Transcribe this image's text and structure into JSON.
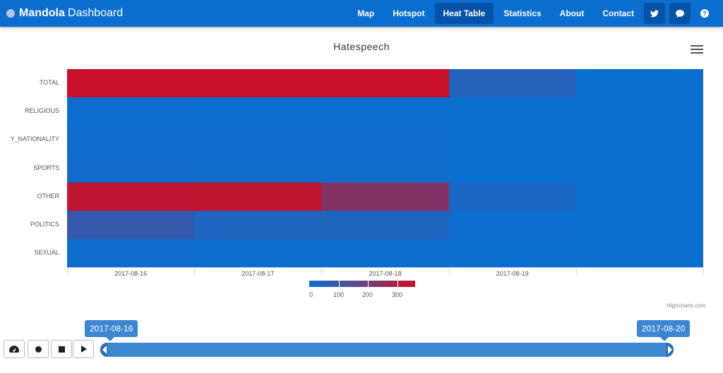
{
  "brand": {
    "name_bold": "Mandola",
    "name_light": "Dashboard"
  },
  "nav": {
    "items": [
      "Map",
      "Hotspot",
      "Heat Table",
      "Statistics",
      "About",
      "Contact"
    ],
    "active": "Heat Table",
    "icons": [
      "twitter-icon",
      "chat-icon",
      "help-icon"
    ]
  },
  "chart": {
    "title": "Hatespeech",
    "credits": "Highcharts.com",
    "legend": {
      "ticks": [
        "0",
        "100",
        "200",
        "300"
      ],
      "min_color": "#0a6ed1",
      "max_color": "#c8102a"
    }
  },
  "chart_data": {
    "type": "heatmap",
    "title": "Hatespeech",
    "x_categories": [
      "2017-08-16",
      "2017-08-17",
      "2017-08-18",
      "2017-08-19",
      ""
    ],
    "y_categories": [
      "TOTAL",
      "RELIGIOUS",
      "Y_NATIONALITY",
      "SPORTS",
      "OTHER",
      "POLITICS",
      "SEXUAL"
    ],
    "values": [
      [
        360,
        360,
        360,
        50,
        0
      ],
      [
        5,
        3,
        3,
        0,
        0
      ],
      [
        10,
        10,
        10,
        0,
        0
      ],
      [
        15,
        12,
        12,
        0,
        0
      ],
      [
        340,
        345,
        230,
        30,
        0
      ],
      [
        80,
        40,
        40,
        5,
        0
      ],
      [
        8,
        5,
        5,
        0,
        0
      ]
    ],
    "color_axis": {
      "min": 0,
      "max": 360,
      "min_color": "#0a6ed1",
      "max_color": "#c8102a"
    }
  },
  "timeline": {
    "start_date": "2017-08-16",
    "end_date": "2017-08-20",
    "buttons": [
      "speed-icon",
      "record-icon",
      "stop-icon",
      "play-icon"
    ]
  }
}
